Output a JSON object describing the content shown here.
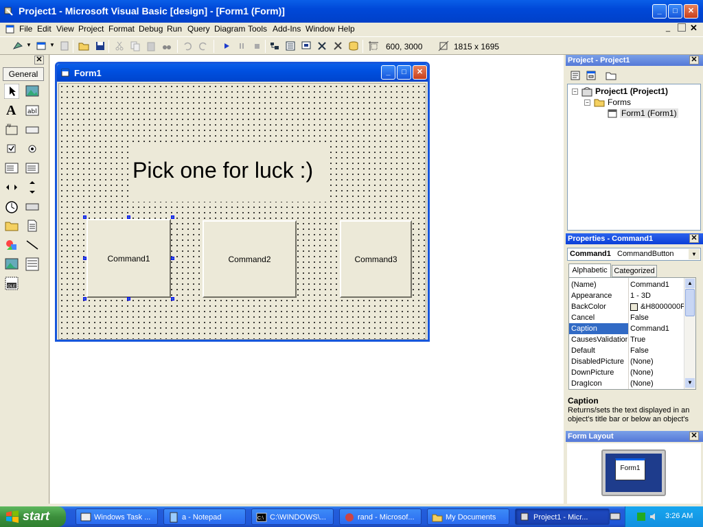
{
  "window": {
    "title": "Project1 - Microsoft Visual Basic [design] - [Form1 (Form)]"
  },
  "menu": [
    "File",
    "Edit",
    "View",
    "Project",
    "Format",
    "Debug",
    "Run",
    "Query",
    "Diagram",
    "Tools",
    "Add-Ins",
    "Window",
    "Help"
  ],
  "toolbar": {
    "position": "600, 3000",
    "size": "1815 x 1695"
  },
  "toolbox": {
    "tab": "General"
  },
  "form": {
    "title": "Form1",
    "label_caption": "Pick one for luck :)",
    "buttons": [
      "Command1",
      "Command2",
      "Command3"
    ]
  },
  "project": {
    "title": "Project - Project1",
    "root": "Project1 (Project1)",
    "folder": "Forms",
    "item": "Form1 (Form1)"
  },
  "properties": {
    "title": "Properties - Command1",
    "object_name": "Command1",
    "object_type": "CommandButton",
    "tabs": [
      "Alphabetic",
      "Categorized"
    ],
    "rows": [
      {
        "name": "(Name)",
        "value": "Command1"
      },
      {
        "name": "Appearance",
        "value": "1 - 3D"
      },
      {
        "name": "BackColor",
        "value": "&H8000000F"
      },
      {
        "name": "Cancel",
        "value": "False"
      },
      {
        "name": "Caption",
        "value": "Command1"
      },
      {
        "name": "CausesValidation",
        "value": "True"
      },
      {
        "name": "Default",
        "value": "False"
      },
      {
        "name": "DisabledPicture",
        "value": "(None)"
      },
      {
        "name": "DownPicture",
        "value": "(None)"
      },
      {
        "name": "DragIcon",
        "value": "(None)"
      }
    ],
    "desc_title": "Caption",
    "desc_text": "Returns/sets the text displayed in an object's title bar or below an object's"
  },
  "form_layout": {
    "title": "Form Layout",
    "preview_label": "Form1"
  },
  "taskbar": {
    "start": "start",
    "tasks": [
      "Windows Task ...",
      "a - Notepad",
      "C:\\WINDOWS\\...",
      "rand - Microsof...",
      "My Documents",
      "Project1 - Micr..."
    ],
    "clock": "3:26 AM"
  },
  "colors": {
    "xp_blue": "#0a5fe8",
    "selection": "#316ac5",
    "taskbar": "#245edb",
    "start_green": "#3c8f3c"
  }
}
